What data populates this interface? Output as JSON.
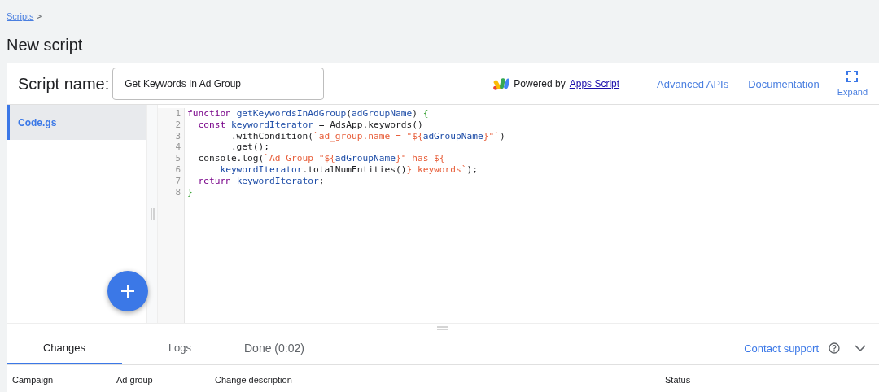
{
  "breadcrumb": {
    "link": "Scripts",
    "separator": ">"
  },
  "page_title": "New script",
  "script_name": {
    "label": "Script name:",
    "value": "Get Keywords In Ad Group"
  },
  "powered_by": {
    "text": "Powered by",
    "link": "Apps Script"
  },
  "header_links": [
    "Advanced APIs",
    "Documentation"
  ],
  "expand_button": {
    "label": "Expand"
  },
  "files": [
    {
      "name": "Code.gs",
      "selected": true
    }
  ],
  "code": {
    "lines": [
      {
        "number": "1",
        "tokens": [
          {
            "kind": "keyword",
            "text": "function "
          },
          {
            "kind": "name",
            "text": "getKeywordsInAdGroup"
          },
          {
            "kind": "plain",
            "text": "("
          },
          {
            "kind": "name",
            "text": "adGroupName"
          },
          {
            "kind": "plain",
            "text": ") "
          },
          {
            "kind": "bracket",
            "text": "{"
          }
        ]
      },
      {
        "number": "2",
        "tokens": [
          {
            "kind": "keyword",
            "text": "  const "
          },
          {
            "kind": "name",
            "text": "keywordIterator"
          },
          {
            "kind": "plain",
            "text": " = AdsApp.keywords()"
          }
        ]
      },
      {
        "number": "3",
        "tokens": [
          {
            "kind": "plain",
            "text": "        .withCondition("
          },
          {
            "kind": "string",
            "text": "`ad_group.name = \"${"
          },
          {
            "kind": "name",
            "text": "adGroupName"
          },
          {
            "kind": "string",
            "text": "}\"`"
          },
          {
            "kind": "plain",
            "text": ")"
          }
        ]
      },
      {
        "number": "4",
        "tokens": [
          {
            "kind": "plain",
            "text": "        .get();"
          }
        ]
      },
      {
        "number": "5",
        "tokens": [
          {
            "kind": "plain",
            "text": "  console.log("
          },
          {
            "kind": "string",
            "text": "`Ad Group \"${"
          },
          {
            "kind": "name",
            "text": "adGroupName"
          },
          {
            "kind": "string",
            "text": "}\" has ${"
          }
        ]
      },
      {
        "number": "6",
        "tokens": [
          {
            "kind": "name",
            "text": "      keywordIterator"
          },
          {
            "kind": "plain",
            "text": ".totalNumEntities()"
          },
          {
            "kind": "string",
            "text": "} keywords`"
          },
          {
            "kind": "plain",
            "text": ");"
          }
        ]
      },
      {
        "number": "7",
        "tokens": [
          {
            "kind": "keyword",
            "text": "  return "
          },
          {
            "kind": "name",
            "text": "keywordIterator"
          },
          {
            "kind": "plain",
            "text": ";"
          }
        ]
      },
      {
        "number": "8",
        "tokens": [
          {
            "kind": "bracket",
            "text": "}"
          }
        ]
      }
    ]
  },
  "bottom_tabs": [
    {
      "label": "Changes",
      "selected": true
    },
    {
      "label": "Logs",
      "selected": false
    }
  ],
  "run_status": "Done (0:02)",
  "contact_support": "Contact support",
  "table": {
    "columns": [
      "Campaign",
      "Ad group",
      "Change description",
      "Status"
    ]
  }
}
